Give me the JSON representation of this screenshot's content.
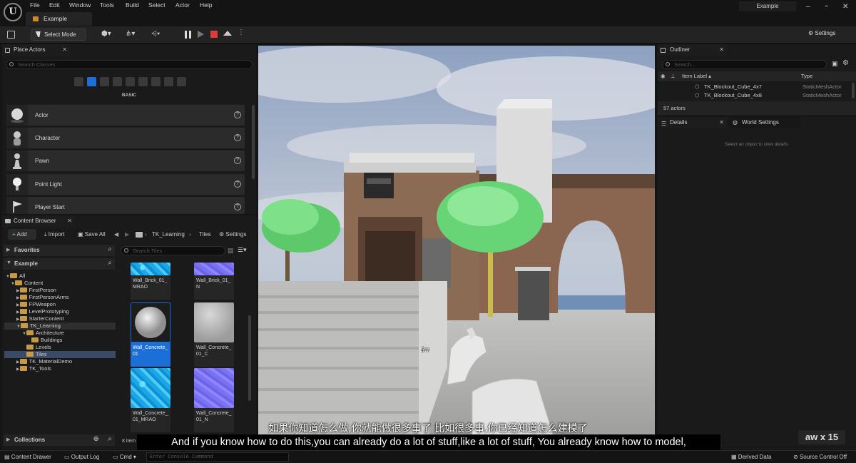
{
  "app": {
    "logo_text": "U",
    "tab_title": "Example",
    "project_name": "Example"
  },
  "menu": [
    "File",
    "Edit",
    "Window",
    "Tools",
    "Build",
    "Select",
    "Actor",
    "Help"
  ],
  "toolbar": {
    "select_mode": "Select Mode",
    "settings": "Settings"
  },
  "place_actors": {
    "tab_label": "Place Actors",
    "search_placeholder": "Search Classes",
    "category": "BASIC",
    "items": [
      {
        "label": "Actor"
      },
      {
        "label": "Character"
      },
      {
        "label": "Pawn"
      },
      {
        "label": "Point Light"
      },
      {
        "label": "Player Start"
      }
    ]
  },
  "content_browser": {
    "tab_label": "Content Browser",
    "add": "Add",
    "import": "Import",
    "save_all": "Save All",
    "breadcrumb": [
      "TK_Learning",
      "Tiles"
    ],
    "settings": "Settings",
    "favorites": "Favorites",
    "project": "Example",
    "search_placeholder": "Search Tiles",
    "tree": [
      {
        "label": "All",
        "level": 0
      },
      {
        "label": "Content",
        "level": 1
      },
      {
        "label": "FirstPerson",
        "level": 2
      },
      {
        "label": "FirstPersonArms",
        "level": 2
      },
      {
        "label": "FPWeapon",
        "level": 2
      },
      {
        "label": "LevelPrototyping",
        "level": 2
      },
      {
        "label": "StarterContent",
        "level": 2
      },
      {
        "label": "TK_Learning",
        "level": 2
      },
      {
        "label": "Architecture",
        "level": 3
      },
      {
        "label": "Buildings",
        "level": 4
      },
      {
        "label": "Levels",
        "level": 3
      },
      {
        "label": "Tiles",
        "level": 3
      },
      {
        "label": "TK_MaterialDemo",
        "level": 2
      },
      {
        "label": "TK_Tools",
        "level": 2
      }
    ],
    "assets": [
      {
        "label": "Wall_Brick_01_MRAO"
      },
      {
        "label": "Wall_Brick_01_N"
      },
      {
        "label": "Wall_Concrete_01"
      },
      {
        "label": "Wall_Concrete_01_C"
      },
      {
        "label": "Wall_Concrete_01_MRAO"
      },
      {
        "label": "Wall_Concrete_01_N"
      }
    ],
    "item_count": "8 item",
    "collections": "Collections"
  },
  "outliner": {
    "tab_label": "Outliner",
    "search_placeholder": "Search...",
    "col_label": "Item Label",
    "col_type": "Type",
    "rows": [
      {
        "label": "TK_Blockout_Cube_4x7",
        "type": "StaticMeshActor"
      },
      {
        "label": "TK_Blockout_Cube_4x8",
        "type": "StaticMeshActor"
      }
    ],
    "count": "57 actors"
  },
  "details": {
    "tab_label": "Details",
    "world_settings": "World Settings",
    "empty_hint": "Select an object to view details."
  },
  "statusbar": {
    "content_drawer": "Content Drawer",
    "output_log": "Output Log",
    "cmd": "Cmd",
    "console_placeholder": "Enter Console Command",
    "derived_data": "Derived Data",
    "source_control": "Source Control Off"
  },
  "viewport": {
    "measure_1": "2m",
    "measure_2": "1m"
  },
  "subtitles": {
    "zh": "如果你知道怎么做,你就能做很多事了 比如很多事,你已经知道怎么建模了",
    "en": "And if you know how to do this,you can already do a lot of stuff,like a lot of stuff, You already know how to model,"
  },
  "watermark": "aw x 15",
  "colors": {
    "accent_blue": "#1c6fd6",
    "folder": "#c89a48",
    "record_red": "#e03a3a"
  }
}
